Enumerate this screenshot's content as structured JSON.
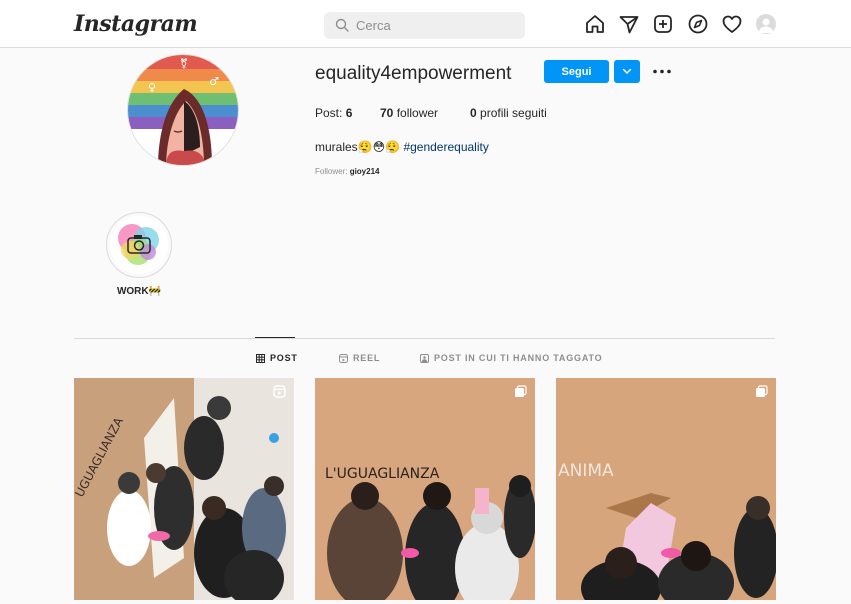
{
  "header": {
    "logo": "Instagram",
    "search": {
      "placeholder": "Cerca"
    },
    "icons": [
      "home-icon",
      "direct-icon",
      "new-post-icon",
      "explore-icon",
      "activity-icon",
      "profile-avatar"
    ]
  },
  "profile": {
    "username": "equality4empowerment",
    "follow_label": "Segui",
    "stats": {
      "posts_label": "Post:",
      "posts_count": "6",
      "followers_count": "70",
      "followers_label": "follower",
      "following_count": "0",
      "following_label": "profili seguiti"
    },
    "bio": {
      "text": "murales",
      "emojis": "😮‍💨😳😮‍💨",
      "hashtag": "#genderequality"
    },
    "followed_by_label": "Follower:",
    "followed_by_user": "gioy214"
  },
  "highlights": [
    {
      "label": "WORK🚧"
    }
  ],
  "tabs": [
    {
      "label": "POST",
      "active": true
    },
    {
      "label": "REEL",
      "active": false
    },
    {
      "label": "POST IN CUI TI HANNO TAGGATO",
      "active": false
    }
  ],
  "posts": [
    {
      "type": "reel",
      "text": ""
    },
    {
      "type": "carousel",
      "text": "L'UGUAGLIANZA"
    },
    {
      "type": "carousel",
      "text": "ANIMA"
    }
  ],
  "colors": {
    "accent": "#0095f6",
    "background": "#fafafa",
    "border": "#dbdbdb",
    "wall": "#d4a882",
    "hashtag": "#00376b"
  }
}
